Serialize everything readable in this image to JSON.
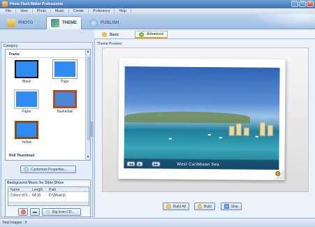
{
  "window": {
    "title": "Photo Flash Maker Professional",
    "controls": {
      "minimize": "_",
      "maximize": "□",
      "close": "×"
    }
  },
  "menu": [
    "File",
    "View",
    "Photo",
    "Music",
    "Create",
    "Preference",
    "Help"
  ],
  "tabs": [
    {
      "label": "Photo",
      "icon": "photo-tab-icon",
      "active": false
    },
    {
      "label": "Theme",
      "icon": "theme-tab-icon",
      "active": true
    },
    {
      "label": "Publish",
      "icon": "publish-tab-icon",
      "active": false
    }
  ],
  "subtabs": [
    {
      "label": "Basic",
      "active": false
    },
    {
      "label": "Advanced",
      "active": true
    }
  ],
  "left": {
    "category_label": "Category:",
    "frame_header": "Frame",
    "thumbnails": [
      {
        "label": "Black"
      },
      {
        "label": "Page"
      },
      {
        "label": "Paper"
      },
      {
        "label": "Basketball"
      },
      {
        "label": "Yellow"
      }
    ],
    "roll_header": "Roll Thumbnail",
    "customize_label": "Customize Properties...",
    "music": {
      "title": "Background Music for Slide Show",
      "columns": [
        "Name",
        "Length",
        "Path"
      ],
      "row": {
        "name": "Colors of F...",
        "length": "04:15",
        "path": "D:\\[Music]\\"
      },
      "rip_label": "Rip from CD..."
    }
  },
  "preview": {
    "label": "Theme Preview:",
    "caption": "West Caribbean Sea"
  },
  "actions": {
    "build_all": "Build All",
    "build": "Build",
    "stop": "Stop"
  },
  "status": {
    "total_images": "Total Images : 9"
  },
  "colors": {
    "accent": "#3f6fb4",
    "highlight": "#f3a21b",
    "panel": "#e4edf8"
  }
}
